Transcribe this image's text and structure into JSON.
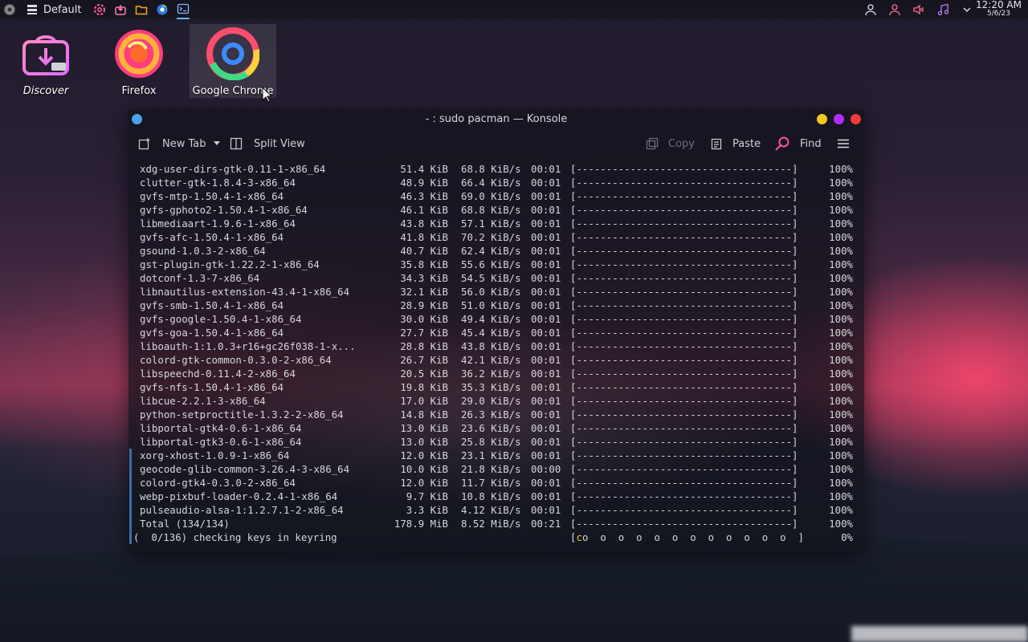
{
  "panel": {
    "activity": "Default",
    "clock_time": "12:20 AM",
    "clock_date": "5/6/23",
    "tasks": [
      {
        "name": "settings-gear-icon",
        "color": "#ff5fa0"
      },
      {
        "name": "discover-icon",
        "color": "#ff7bb3"
      },
      {
        "name": "folder-icon",
        "color": "#f5a623"
      },
      {
        "name": "chrome-icon",
        "color": "#4ea1ff"
      },
      {
        "name": "terminal-icon",
        "color": "#7fb8ff"
      }
    ]
  },
  "desktop": {
    "icons": [
      {
        "label": "Discover"
      },
      {
        "label": "Firefox"
      },
      {
        "label": "Google Chrome"
      }
    ]
  },
  "window": {
    "title": "- : sudo pacman — Konsole",
    "toolbar": {
      "new_tab": "New Tab",
      "split_view": "Split View",
      "copy": "Copy",
      "paste": "Paste",
      "find": "Find"
    },
    "colors": {
      "close": "#ef3b3b",
      "maximize": "#b42cff",
      "minimize": "#f2c81c",
      "app_dot": "#4aa3e8"
    }
  },
  "terminal": {
    "rows": [
      {
        "name": "xdg-user-dirs-gtk-0.11-1-x86_64",
        "size": "51.4 KiB",
        "speed": "68.8 KiB/s",
        "time": "00:01",
        "bar": "[------------------------------------]",
        "pct": "100%"
      },
      {
        "name": "clutter-gtk-1.8.4-3-x86_64",
        "size": "48.9 KiB",
        "speed": "66.4 KiB/s",
        "time": "00:01",
        "bar": "[------------------------------------]",
        "pct": "100%"
      },
      {
        "name": "gvfs-mtp-1.50.4-1-x86_64",
        "size": "46.3 KiB",
        "speed": "69.0 KiB/s",
        "time": "00:01",
        "bar": "[------------------------------------]",
        "pct": "100%"
      },
      {
        "name": "gvfs-gphoto2-1.50.4-1-x86_64",
        "size": "46.1 KiB",
        "speed": "68.8 KiB/s",
        "time": "00:01",
        "bar": "[------------------------------------]",
        "pct": "100%"
      },
      {
        "name": "libmediaart-1.9.6-1-x86_64",
        "size": "43.8 KiB",
        "speed": "57.1 KiB/s",
        "time": "00:01",
        "bar": "[------------------------------------]",
        "pct": "100%"
      },
      {
        "name": "gvfs-afc-1.50.4-1-x86_64",
        "size": "41.8 KiB",
        "speed": "70.2 KiB/s",
        "time": "00:01",
        "bar": "[------------------------------------]",
        "pct": "100%"
      },
      {
        "name": "gsound-1.0.3-2-x86_64",
        "size": "40.7 KiB",
        "speed": "62.4 KiB/s",
        "time": "00:01",
        "bar": "[------------------------------------]",
        "pct": "100%"
      },
      {
        "name": "gst-plugin-gtk-1.22.2-1-x86_64",
        "size": "35.8 KiB",
        "speed": "55.6 KiB/s",
        "time": "00:01",
        "bar": "[------------------------------------]",
        "pct": "100%"
      },
      {
        "name": "dotconf-1.3-7-x86_64",
        "size": "34.3 KiB",
        "speed": "54.5 KiB/s",
        "time": "00:01",
        "bar": "[------------------------------------]",
        "pct": "100%"
      },
      {
        "name": "libnautilus-extension-43.4-1-x86_64",
        "size": "32.1 KiB",
        "speed": "56.0 KiB/s",
        "time": "00:01",
        "bar": "[------------------------------------]",
        "pct": "100%"
      },
      {
        "name": "gvfs-smb-1.50.4-1-x86_64",
        "size": "28.9 KiB",
        "speed": "51.0 KiB/s",
        "time": "00:01",
        "bar": "[------------------------------------]",
        "pct": "100%"
      },
      {
        "name": "gvfs-google-1.50.4-1-x86_64",
        "size": "30.0 KiB",
        "speed": "49.4 KiB/s",
        "time": "00:01",
        "bar": "[------------------------------------]",
        "pct": "100%"
      },
      {
        "name": "gvfs-goa-1.50.4-1-x86_64",
        "size": "27.7 KiB",
        "speed": "45.4 KiB/s",
        "time": "00:01",
        "bar": "[------------------------------------]",
        "pct": "100%"
      },
      {
        "name": "liboauth-1:1.0.3+r16+gc26f038-1-x...",
        "size": "28.8 KiB",
        "speed": "43.8 KiB/s",
        "time": "00:01",
        "bar": "[------------------------------------]",
        "pct": "100%"
      },
      {
        "name": "colord-gtk-common-0.3.0-2-x86_64",
        "size": "26.7 KiB",
        "speed": "42.1 KiB/s",
        "time": "00:01",
        "bar": "[------------------------------------]",
        "pct": "100%"
      },
      {
        "name": "libspeechd-0.11.4-2-x86_64",
        "size": "20.5 KiB",
        "speed": "36.2 KiB/s",
        "time": "00:01",
        "bar": "[------------------------------------]",
        "pct": "100%"
      },
      {
        "name": "gvfs-nfs-1.50.4-1-x86_64",
        "size": "19.8 KiB",
        "speed": "35.3 KiB/s",
        "time": "00:01",
        "bar": "[------------------------------------]",
        "pct": "100%"
      },
      {
        "name": "libcue-2.2.1-3-x86_64",
        "size": "17.0 KiB",
        "speed": "29.0 KiB/s",
        "time": "00:01",
        "bar": "[------------------------------------]",
        "pct": "100%"
      },
      {
        "name": "python-setproctitle-1.3.2-2-x86_64",
        "size": "14.8 KiB",
        "speed": "26.3 KiB/s",
        "time": "00:01",
        "bar": "[------------------------------------]",
        "pct": "100%"
      },
      {
        "name": "libportal-gtk4-0.6-1-x86_64",
        "size": "13.0 KiB",
        "speed": "23.6 KiB/s",
        "time": "00:01",
        "bar": "[------------------------------------]",
        "pct": "100%"
      },
      {
        "name": "libportal-gtk3-0.6-1-x86_64",
        "size": "13.0 KiB",
        "speed": "25.8 KiB/s",
        "time": "00:01",
        "bar": "[------------------------------------]",
        "pct": "100%"
      },
      {
        "name": "xorg-xhost-1.0.9-1-x86_64",
        "size": "12.0 KiB",
        "speed": "23.1 KiB/s",
        "time": "00:01",
        "bar": "[------------------------------------]",
        "pct": "100%"
      },
      {
        "name": "geocode-glib-common-3.26.4-3-x86_64",
        "size": "10.0 KiB",
        "speed": "21.8 KiB/s",
        "time": "00:00",
        "bar": "[------------------------------------]",
        "pct": "100%"
      },
      {
        "name": "colord-gtk4-0.3.0-2-x86_64",
        "size": "12.0 KiB",
        "speed": "11.7 KiB/s",
        "time": "00:01",
        "bar": "[------------------------------------]",
        "pct": "100%"
      },
      {
        "name": "webp-pixbuf-loader-0.2.4-1-x86_64",
        "size": "9.7 KiB",
        "speed": "10.8 KiB/s",
        "time": "00:01",
        "bar": "[------------------------------------]",
        "pct": "100%"
      },
      {
        "name": "pulseaudio-alsa-1:1.2.7.1-2-x86_64",
        "size": "3.3 KiB",
        "speed": "4.12 KiB/s",
        "time": "00:01",
        "bar": "[------------------------------------]",
        "pct": "100%"
      },
      {
        "name": "Total (134/134)",
        "size": "178.9 MiB",
        "speed": "8.52 MiB/s",
        "time": "00:21",
        "bar": "[------------------------------------]",
        "pct": "100%"
      }
    ],
    "last_line": {
      "text": "(  0/136) checking keys in keyring",
      "bar_open": "[",
      "bar_c": "c",
      "bar_rest": "o  o  o  o  o  o  o  o  o  o  o  o  ]",
      "pct": "0%"
    }
  }
}
